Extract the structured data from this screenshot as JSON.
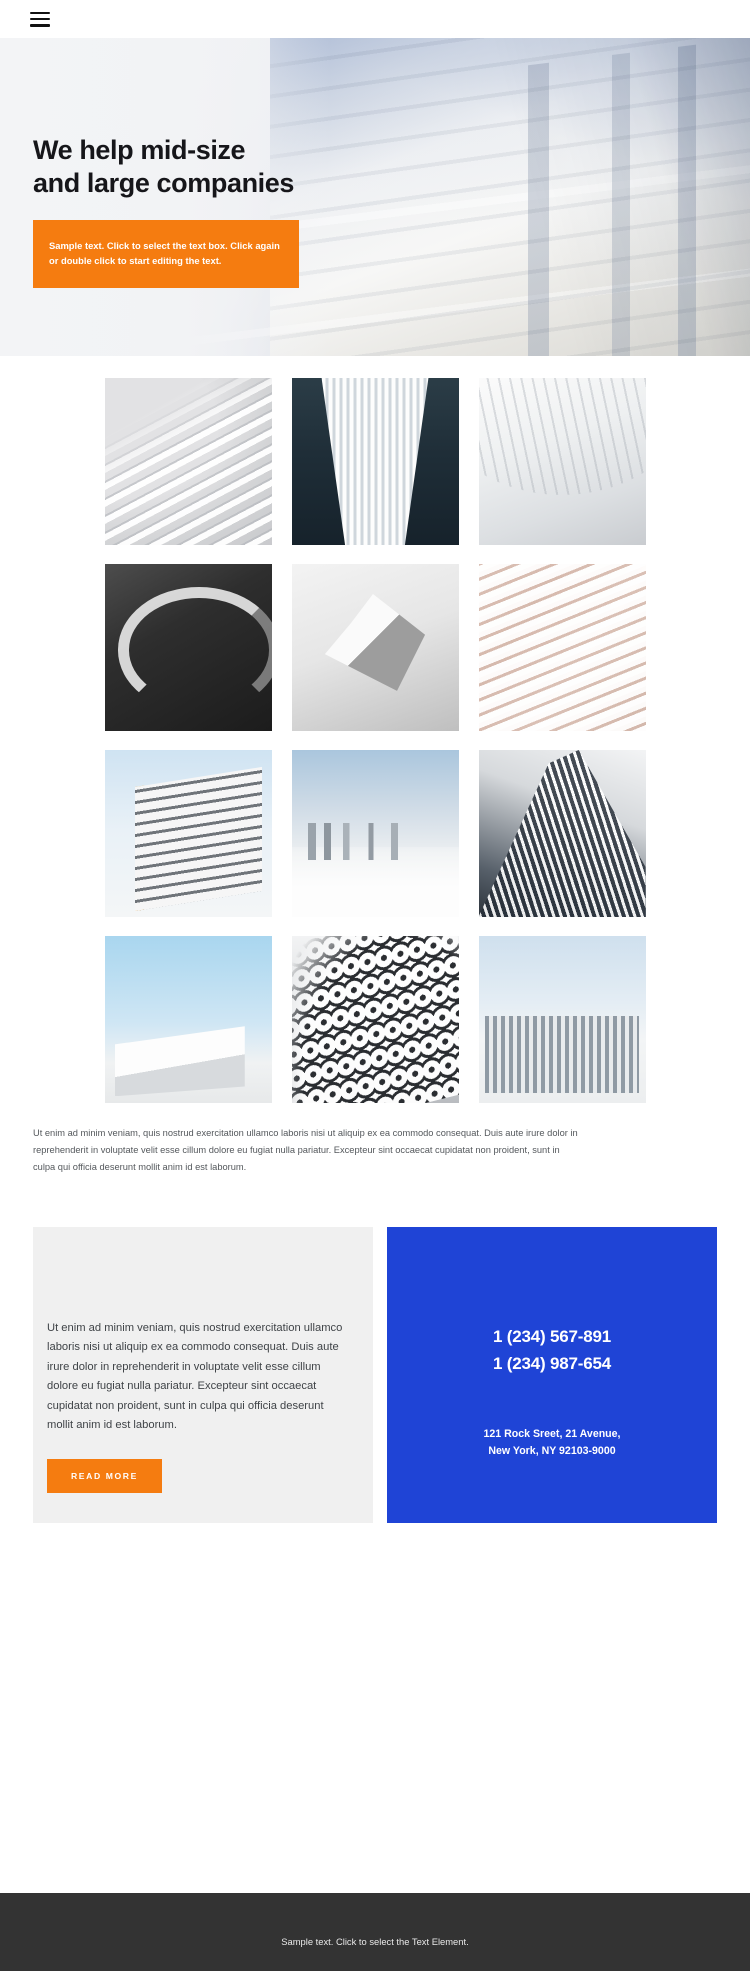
{
  "header": {
    "menu_icon": "hamburger-menu-icon"
  },
  "hero": {
    "title": "We help mid-size\nand large companies",
    "callout": "Sample text. Click to select the text box. Click again or double click to start editing the text.",
    "callout_bg": "#f57c10"
  },
  "gallery": {
    "tiles": [
      {
        "alt": "white-louvered-facade"
      },
      {
        "alt": "dark-symmetrical-atrium"
      },
      {
        "alt": "white-vaulted-corridor"
      },
      {
        "alt": "concrete-spiral-staircase"
      },
      {
        "alt": "grey-angular-sculpture"
      },
      {
        "alt": "pink-balcony-facade"
      },
      {
        "alt": "modern-apartment-balconies"
      },
      {
        "alt": "skyscrapers-above-clouds"
      },
      {
        "alt": "glass-towers-upward-view"
      },
      {
        "alt": "white-building-blue-sky"
      },
      {
        "alt": "scaled-pattern-facade"
      },
      {
        "alt": "glass-office-block"
      }
    ],
    "caption": "Ut enim ad minim veniam, quis nostrud exercitation ullamco laboris nisi ut aliquip ex ea commodo consequat. Duis aute irure dolor in reprehenderit in voluptate velit esse cillum dolore eu fugiat nulla pariatur. Excepteur sint occaecat cupidatat non proident, sunt in culpa qui officia deserunt mollit anim id est laborum."
  },
  "info_card": {
    "body": "Ut enim ad minim veniam, quis nostrud exercitation ullamco laboris nisi ut aliquip ex ea commodo consequat. Duis aute irure dolor in reprehenderit in voluptate velit esse cillum dolore eu fugiat nulla pariatur. Excepteur sint occaecat cupidatat non proident, sunt in culpa qui officia deserunt mollit anim id est laborum.",
    "button_label": "READ MORE",
    "button_bg": "#f57c10"
  },
  "contact_card": {
    "bg": "#1f44d6",
    "phone_primary": "1 (234) 567-891",
    "phone_secondary": "1 (234) 987-654",
    "address_line1": "121 Rock Sreet, 21 Avenue,",
    "address_line2": "New York, NY 92103-9000"
  },
  "footer": {
    "text": "Sample text. Click to select the Text Element.",
    "bg": "#333333"
  }
}
